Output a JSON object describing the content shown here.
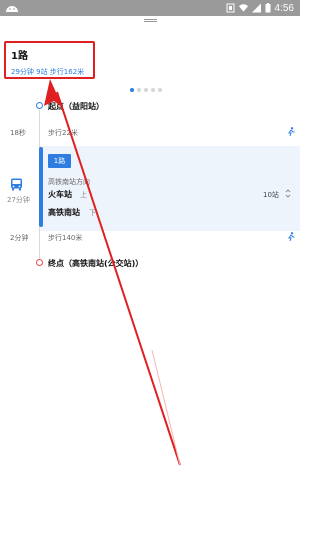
{
  "status_bar": {
    "time": "4:56"
  },
  "route": {
    "title": "1路",
    "summary": "29分钟 9站 步行162米"
  },
  "pagination": {
    "count": 5,
    "active_index": 0
  },
  "steps": {
    "start_label": "起点（益阳站）",
    "walk1_time": "18秒",
    "walk1_text": "步行22米",
    "bus": {
      "line": "1路",
      "direction": "高铁南站方向",
      "ride_time": "27分钟",
      "board_station": "火车站",
      "board_tag": "上",
      "alight_station": "高铁南站",
      "alight_tag": "下",
      "stop_count": "10站"
    },
    "walk2_time": "2分钟",
    "walk2_text": "步行140米",
    "end_label": "终点（高铁南站(公交站)）"
  },
  "colors": {
    "accent": "#2f7de1",
    "highlight": "#e02020",
    "statusbar": "#9a9a9a"
  },
  "icons": [
    "android-icon",
    "notification-icon",
    "wifi-icon",
    "signal-icon",
    "battery-icon",
    "walk-icon",
    "bus-icon",
    "expand-icon"
  ]
}
